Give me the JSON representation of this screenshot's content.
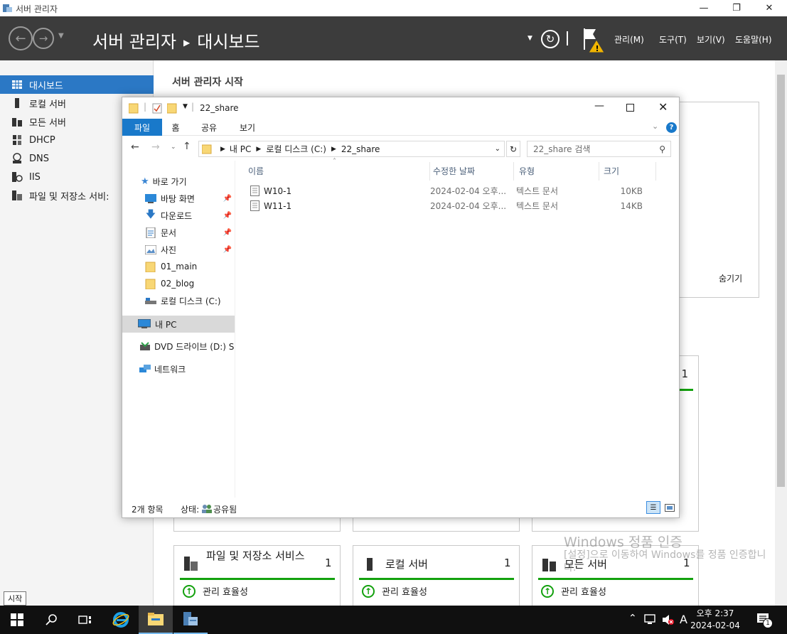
{
  "window": {
    "title": "서버 관리자",
    "min": "—",
    "restore": "❐",
    "close": "✕"
  },
  "header": {
    "breadcrumb_app": "서버 관리자",
    "breadcrumb_page": "대시보드",
    "menus": [
      "관리(M)",
      "도구(T)",
      "보기(V)",
      "도움말(H)"
    ]
  },
  "sidebar": {
    "items": [
      {
        "label": "대시보드",
        "icon": "dashboard-icon"
      },
      {
        "label": "로컬 서버",
        "icon": "server-icon"
      },
      {
        "label": "모든 서버",
        "icon": "servers-icon"
      },
      {
        "label": "DHCP",
        "icon": "dhcp-icon"
      },
      {
        "label": "DNS",
        "icon": "dns-icon"
      },
      {
        "label": "IIS",
        "icon": "iis-icon"
      },
      {
        "label": "파일 및 저장소 서비:",
        "icon": "storage-icon"
      }
    ]
  },
  "main": {
    "title": "서버 관리자 시작",
    "hide_label": "숨기기",
    "partial_count": "1",
    "tiles": [
      {
        "title": "파일 및 저장소 서비스",
        "count": "1",
        "row": "관리 효율성"
      },
      {
        "title": "로컬 서버",
        "count": "1",
        "row": "관리 효율성"
      },
      {
        "title": "모든 서버",
        "count": "1",
        "row": "관리 효율성"
      }
    ]
  },
  "explorer": {
    "title": "22_share",
    "ribbon_tabs": [
      "파일",
      "홈",
      "공유",
      "보기"
    ],
    "address": [
      "내 PC",
      "로컬 디스크 (C:)",
      "22_share"
    ],
    "search_placeholder": "22_share 검색",
    "nav": {
      "quick_access": "바로 가기",
      "pinned": [
        {
          "label": "바탕 화면",
          "icon": "desktop-icon",
          "pinned": true
        },
        {
          "label": "다운로드",
          "icon": "download-icon",
          "pinned": true
        },
        {
          "label": "문서",
          "icon": "document-icon",
          "pinned": true
        },
        {
          "label": "사진",
          "icon": "pictures-icon",
          "pinned": true
        },
        {
          "label": "01_main",
          "icon": "folder-icon",
          "pinned": false
        },
        {
          "label": "02_blog",
          "icon": "folder-icon",
          "pinned": false
        },
        {
          "label": "로컬 디스크 (C:)",
          "icon": "drive-icon",
          "pinned": false
        }
      ],
      "this_pc": "내 PC",
      "dvd": "DVD 드라이브 (D:) S",
      "network": "네트워크"
    },
    "columns": {
      "name": "이름",
      "date": "수정한 날짜",
      "type": "유형",
      "size": "크기"
    },
    "files": [
      {
        "name": "W10-1",
        "date": "2024-02-04 오후...",
        "type": "텍스트 문서",
        "size": "10KB"
      },
      {
        "name": "W11-1",
        "date": "2024-02-04 오후...",
        "type": "텍스트 문서",
        "size": "14KB"
      }
    ],
    "status_count": "2개 항목",
    "status_state_label": "상태:",
    "status_state_value": "공유됨"
  },
  "watermark": {
    "line1": "Windows 정품 인증",
    "line2": "[설정]으로 이동하여 Windows를 정품 인증합니다."
  },
  "taskbar": {
    "start_tooltip": "시작",
    "ime": "A",
    "time": "오후 2:37",
    "date": "2024-02-04",
    "notif_count": "1"
  },
  "colors": {
    "accent": "#1979ca",
    "sidebar_active": "#2b78c5",
    "status_green": "#13a10e",
    "header": "#3c3c3c"
  }
}
